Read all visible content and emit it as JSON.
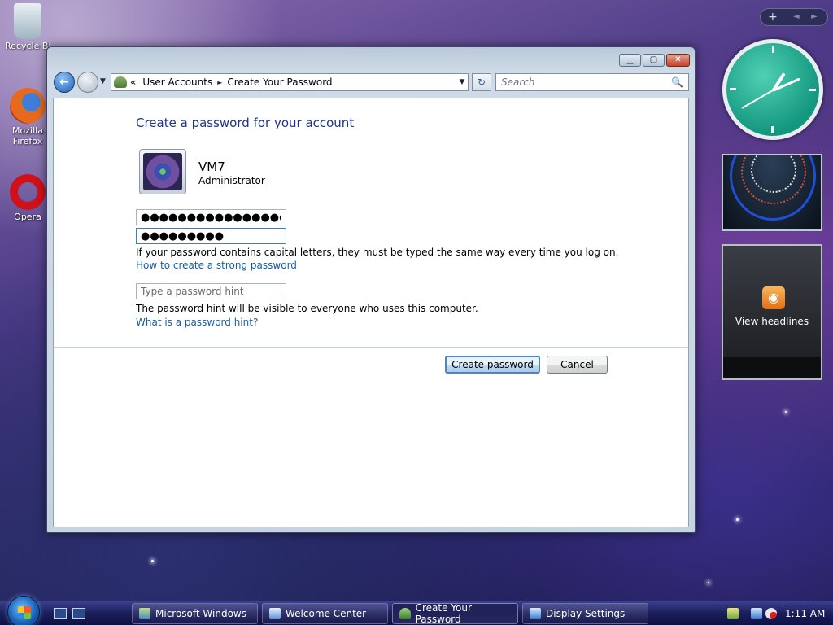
{
  "desktop": {
    "icons": [
      {
        "label": "Recycle Bin",
        "icon": "recycle-bin-icon"
      },
      {
        "label": "Mozilla Firefox",
        "icon": "firefox-icon"
      },
      {
        "label": "Opera",
        "icon": "opera-icon"
      }
    ]
  },
  "window": {
    "controls": {
      "minimize": "▁",
      "maximize": "▢",
      "close": "✕"
    },
    "nav": {
      "back": "←",
      "forward": "→",
      "recent": "▼"
    },
    "address": {
      "overflow": "«",
      "crumbs": [
        "User Accounts",
        "Create Your Password"
      ],
      "separator": "►",
      "dropdown": "▼"
    },
    "refresh": "↻",
    "search": {
      "placeholder": "Search",
      "icon": "🔍"
    }
  },
  "content": {
    "title": "Create a password for your account",
    "user": {
      "name": "VM7",
      "role": "Administrator"
    },
    "password_value": "●●●●●●●●●●●●●●●●",
    "confirm_value": "●●●●●●●●●",
    "case_note": "If your password contains capital letters, they must be typed the same way every time you log on.",
    "strong_link": "How to create a strong password",
    "hint_placeholder": "Type a password hint",
    "hint_note": "The password hint will be visible to everyone who uses this computer.",
    "hint_link": "What is a password hint?",
    "create_button": "Create password",
    "cancel_button": "Cancel"
  },
  "gadgets": {
    "toolbar": {
      "add": "+",
      "prev": "◄",
      "next": "►"
    },
    "feed_label": "View headlines",
    "rss_glyph": "◉"
  },
  "taskbar": {
    "tasks": [
      {
        "label": "Microsoft Windows",
        "icon": "windows-setup-icon",
        "active": false
      },
      {
        "label": "Welcome Center",
        "icon": "welcome-center-icon",
        "active": false
      },
      {
        "label": "Create Your Password",
        "icon": "user-accounts-icon",
        "active": true
      },
      {
        "label": "Display Settings",
        "icon": "display-settings-icon",
        "active": false
      }
    ],
    "time": "1:11 AM"
  },
  "colors": {
    "title_blue": "#1e3287",
    "link_blue": "#1a5ea8",
    "clock_face": "#14977f",
    "taskbar": "#1b1e5a"
  }
}
